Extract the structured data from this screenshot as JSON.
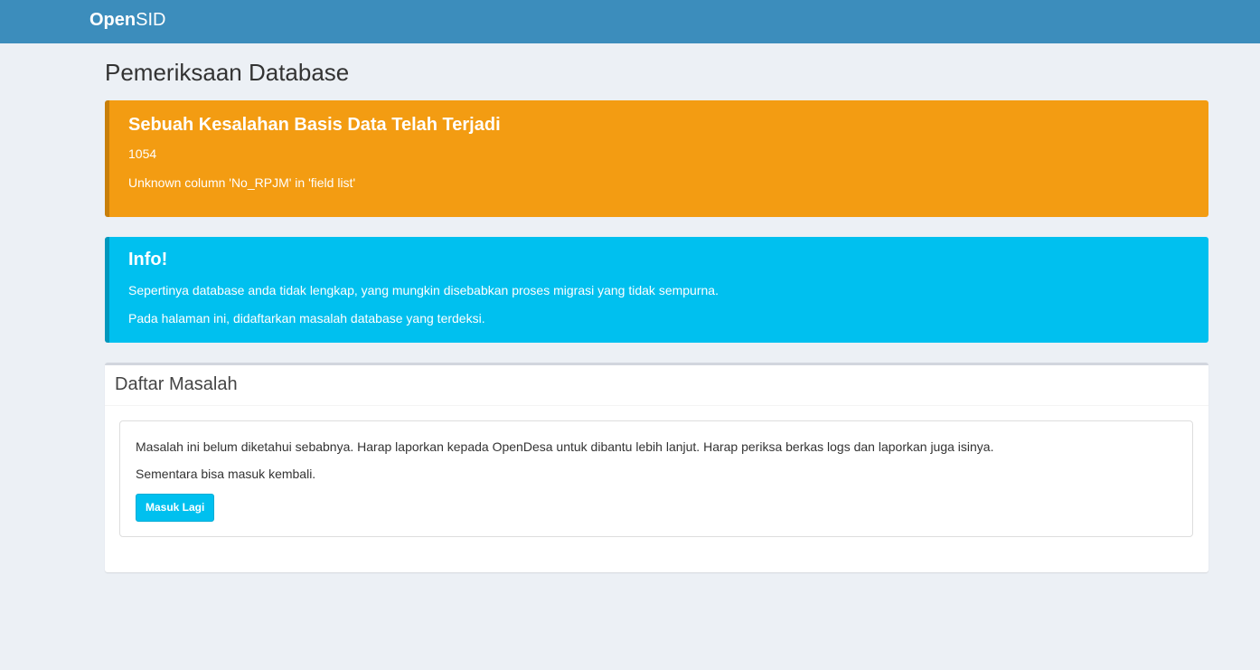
{
  "header": {
    "brand_part1": "Open",
    "brand_part2": "SID"
  },
  "page": {
    "title": "Pemeriksaan Database"
  },
  "error_callout": {
    "heading": "Sebuah Kesalahan Basis Data Telah Terjadi",
    "code": "1054",
    "message": "Unknown column 'No_RPJM' in 'field list'",
    "color": "#f39c12"
  },
  "info_callout": {
    "heading": "Info!",
    "line1": "Sepertinya database anda tidak lengkap, yang mungkin disebabkan proses migrasi yang tidak sempurna.",
    "line2": "Pada halaman ini, didaftarkan masalah database yang terdeksi.",
    "color": "#00c0ef"
  },
  "problems_box": {
    "title": "Daftar Masalah",
    "message1": "Masalah ini belum diketahui sebabnya. Harap laporkan kepada OpenDesa untuk dibantu lebih lanjut. Harap periksa berkas logs dan laporkan juga isinya.",
    "message2": "Sementara bisa masuk kembali.",
    "button_label": "Masuk Lagi"
  }
}
